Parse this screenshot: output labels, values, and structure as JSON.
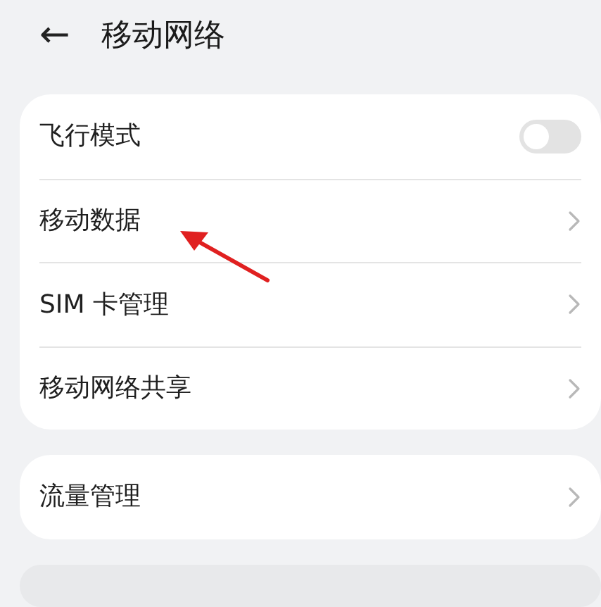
{
  "header": {
    "back": "←",
    "title": "移动网络"
  },
  "groups": [
    {
      "items": [
        {
          "kind": "toggle",
          "label": "飞行模式",
          "on": false,
          "arrow_pointed": false
        },
        {
          "kind": "link",
          "label": "移动数据",
          "arrow_pointed": true
        },
        {
          "kind": "link",
          "label": "SIM 卡管理",
          "arrow_pointed": false
        },
        {
          "kind": "link",
          "label": "移动网络共享",
          "arrow_pointed": false
        }
      ]
    },
    {
      "items": [
        {
          "kind": "link",
          "label": "流量管理",
          "arrow_pointed": false
        }
      ]
    }
  ]
}
